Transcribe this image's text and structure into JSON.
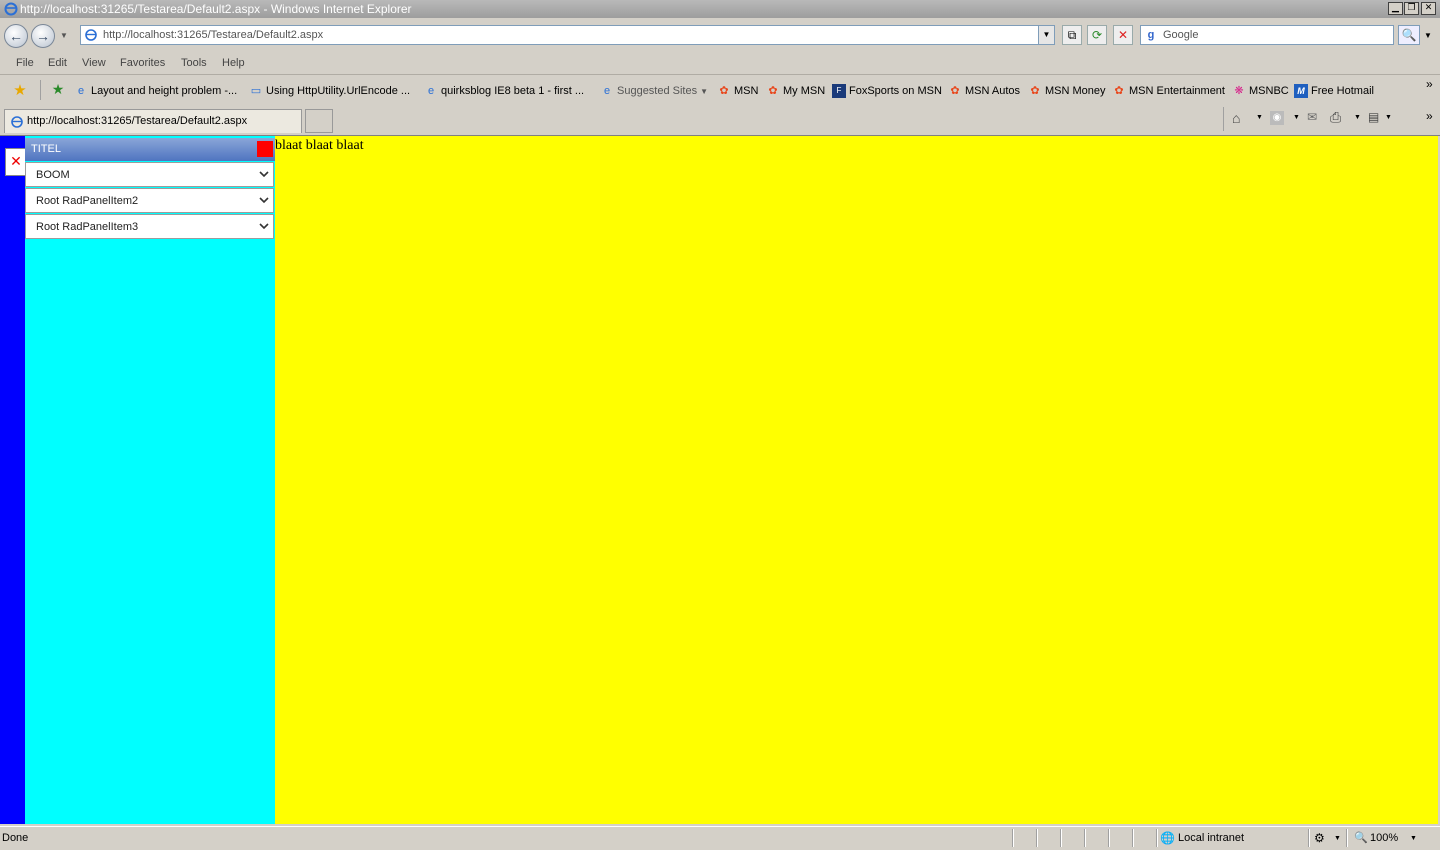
{
  "window": {
    "title": "http://localhost:31265/Testarea/Default2.aspx - Windows Internet Explorer",
    "minimize_glyph": "▁",
    "restore_glyph": "❐",
    "close_glyph": "✕"
  },
  "address": {
    "url": "http://localhost:31265/Testarea/Default2.aspx",
    "dropdown_glyph": "▼"
  },
  "search": {
    "placeholder": "Google",
    "glyph": "🔍"
  },
  "menu": {
    "items": [
      "File",
      "Edit",
      "View",
      "Favorites",
      "Tools",
      "Help"
    ]
  },
  "favorites": {
    "items": [
      "Layout and height problem -...",
      "Using HttpUtility.UrlEncode ...",
      "quirksblog IE8 beta 1 - first ...",
      "Suggested Sites",
      "MSN",
      "My MSN",
      "FoxSports on MSN",
      "MSN Autos",
      "MSN Money",
      "MSN Entertainment",
      "MSNBC",
      "Free Hotmail"
    ],
    "overflow_glyph": "»"
  },
  "tab": {
    "label": "http://localhost:31265/Testarea/Default2.aspx"
  },
  "panel": {
    "title": "TITEL",
    "items": [
      "BOOM",
      "Root RadPanelItem2",
      "Root RadPanelItem3"
    ]
  },
  "page": {
    "text": "blaat blaat blaat"
  },
  "status": {
    "text": "Done",
    "zone": "Local intranet",
    "zoom": "100%"
  },
  "colors": {
    "content_bg": "#ffff00",
    "panel_bg": "#00ffff",
    "strip": "#0000ff",
    "close": "#ff0000"
  }
}
